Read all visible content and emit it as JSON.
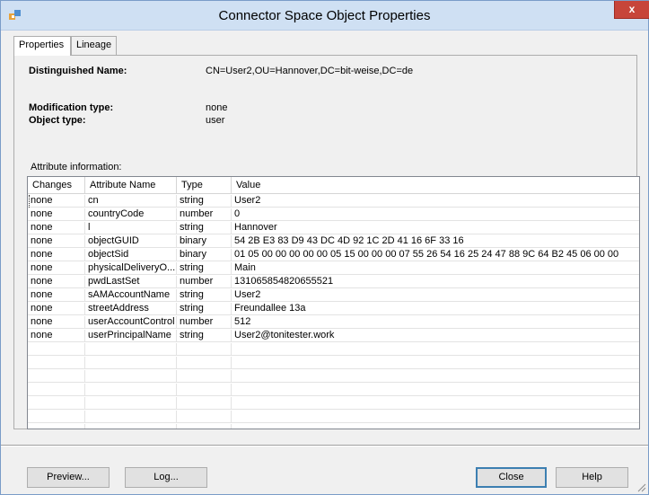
{
  "window": {
    "title": "Connector Space Object Properties",
    "close_label": "x"
  },
  "tabs": [
    {
      "label": "Properties",
      "active": true
    },
    {
      "label": "Lineage",
      "active": false
    }
  ],
  "properties": {
    "dn_label": "Distinguished Name:",
    "dn_value": "CN=User2,OU=Hannover,DC=bit-weise,DC=de",
    "modtype_label": "Modification type:",
    "modtype_value": "none",
    "objtype_label": "Object type:",
    "objtype_value": "user",
    "attr_group_label": "Attribute information:"
  },
  "grid": {
    "columns": [
      "Changes",
      "Attribute Name",
      "Type",
      "Value"
    ],
    "rows": [
      [
        "none",
        "cn",
        "string",
        "User2"
      ],
      [
        "none",
        "countryCode",
        "number",
        "0"
      ],
      [
        "none",
        "l",
        "string",
        "Hannover"
      ],
      [
        "none",
        "objectGUID",
        "binary",
        "54 2B E3 83 D9 43 DC 4D 92 1C 2D 41 16 6F 33 16"
      ],
      [
        "none",
        "objectSid",
        "binary",
        "01 05 00 00 00 00 00 05 15 00 00 00 07 55 26 54 16 25 24 47 88 9C 64 B2 45 06 00 00"
      ],
      [
        "none",
        "physicalDeliveryO...",
        "string",
        "Main"
      ],
      [
        "none",
        "pwdLastSet",
        "number",
        "131065854820655521"
      ],
      [
        "none",
        "sAMAccountName",
        "string",
        "User2"
      ],
      [
        "none",
        "streetAddress",
        "string",
        "Freundallee 13a"
      ],
      [
        "none",
        "userAccountControl",
        "number",
        "512"
      ],
      [
        "none",
        "userPrincipalName",
        "string",
        "User2@tonitester.work"
      ]
    ],
    "empty_rows": 7
  },
  "buttons": {
    "preview": "Preview...",
    "log": "Log...",
    "close": "Close",
    "help": "Help"
  }
}
